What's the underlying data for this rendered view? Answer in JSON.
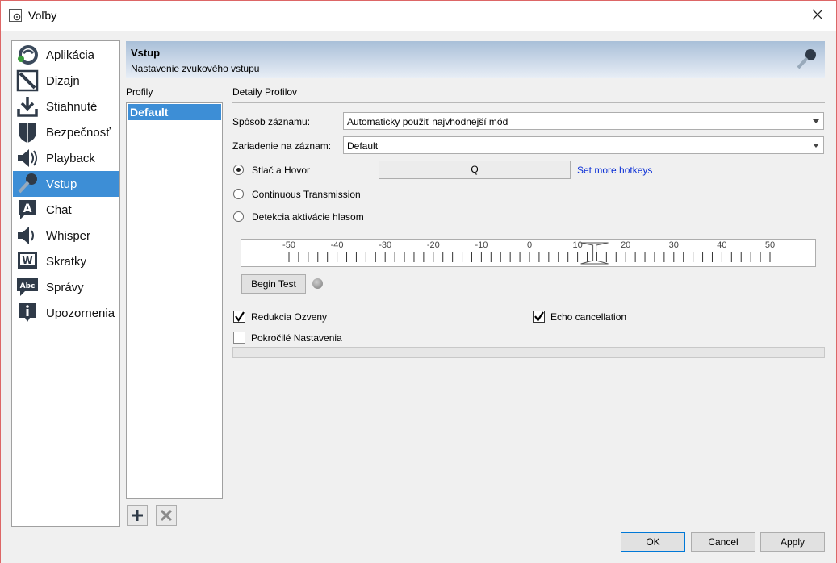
{
  "window": {
    "title": "Voľby"
  },
  "sidebar": {
    "items": [
      {
        "label": "Aplikácia",
        "icon": "teamspeak-icon"
      },
      {
        "label": "Dizajn",
        "icon": "design-icon"
      },
      {
        "label": "Stiahnuté",
        "icon": "download-icon"
      },
      {
        "label": "Bezpečnosť",
        "icon": "shield-icon"
      },
      {
        "label": "Playback",
        "icon": "speaker-icon"
      },
      {
        "label": "Vstup",
        "icon": "microphone-icon",
        "active": true
      },
      {
        "label": "Chat",
        "icon": "chat-icon"
      },
      {
        "label": "Whisper",
        "icon": "whisper-speaker-icon"
      },
      {
        "label": "Skratky",
        "icon": "hotkeys-icon"
      },
      {
        "label": "Správy",
        "icon": "messages-icon"
      },
      {
        "label": "Upozornenia",
        "icon": "notifications-icon"
      }
    ]
  },
  "header": {
    "title": "Vstup",
    "subtitle": "Nastavenie zvukového vstupu"
  },
  "profiles": {
    "label": "Profily",
    "items": [
      "Default"
    ]
  },
  "details": {
    "label": "Detaily Profilov",
    "capture_mode_label": "Spôsob záznamu:",
    "capture_mode_value": "Automaticky použiť najvhodnejší mód",
    "capture_device_label": "Zariadenie na záznam:",
    "capture_device_value": "Default",
    "ptt_label": "Stlač a Hovor",
    "ptt_selected": true,
    "hotkey_value": "Q",
    "more_hotkeys": "Set more hotkeys",
    "continuous_label": "Continuous Transmission",
    "vad_label": "Detekcia aktivácie hlasom",
    "meter_ticks": [
      "-50",
      "-40",
      "-30",
      "-20",
      "-10",
      "0",
      "10",
      "20",
      "30",
      "40",
      "50"
    ],
    "meter_value": 10,
    "begin_test": "Begin Test",
    "echo_reduction_label": "Redukcia Ozveny",
    "echo_reduction_checked": true,
    "echo_cancellation_label": "Echo cancellation",
    "echo_cancellation_checked": true,
    "advanced_label": "Pokročilé Nastavenia",
    "advanced_checked": false
  },
  "footer": {
    "ok": "OK",
    "cancel": "Cancel",
    "apply": "Apply"
  },
  "colors": {
    "accent": "#3d8ed6",
    "link": "#0b2fd6"
  }
}
